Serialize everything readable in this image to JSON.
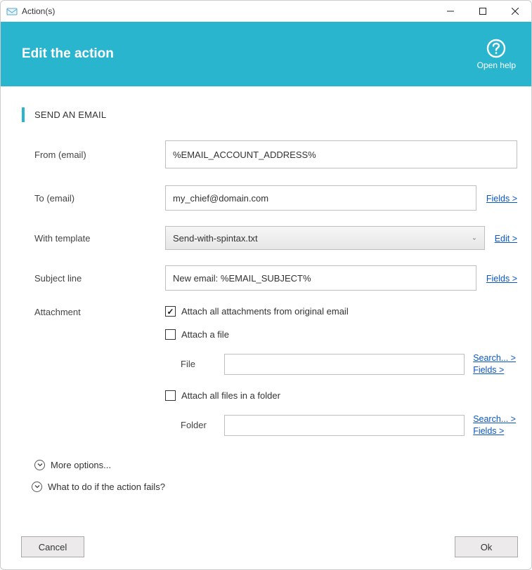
{
  "titlebar": {
    "title": "Action(s)"
  },
  "header": {
    "title": "Edit the action",
    "help_label": "Open help"
  },
  "section": {
    "title": "SEND AN EMAIL"
  },
  "from": {
    "label": "From (email)",
    "value": "%EMAIL_ACCOUNT_ADDRESS%"
  },
  "to": {
    "label": "To (email)",
    "value": "my_chief@domain.com",
    "fields_link": "Fields >"
  },
  "template": {
    "label": "With template",
    "selected": "Send-with-spintax.txt",
    "edit_link": "Edit >"
  },
  "subject": {
    "label": "Subject line",
    "value": "New email: %EMAIL_SUBJECT%",
    "fields_link": "Fields >"
  },
  "attachment": {
    "label": "Attachment",
    "attach_all_label": "Attach all attachments from original email",
    "attach_all_checked": true,
    "attach_file_label": "Attach a file",
    "attach_file_checked": false,
    "file": {
      "label": "File",
      "value": "",
      "search_link": "Search... >",
      "fields_link": "Fields >"
    },
    "attach_folder_label": "Attach all files in a folder",
    "attach_folder_checked": false,
    "folder": {
      "label": "Folder",
      "value": "",
      "search_link": "Search... >",
      "fields_link": "Fields >"
    }
  },
  "expanders": {
    "more_options": "More options...",
    "on_fail": "What to do if the action fails?"
  },
  "footer": {
    "cancel": "Cancel",
    "ok": "Ok"
  }
}
